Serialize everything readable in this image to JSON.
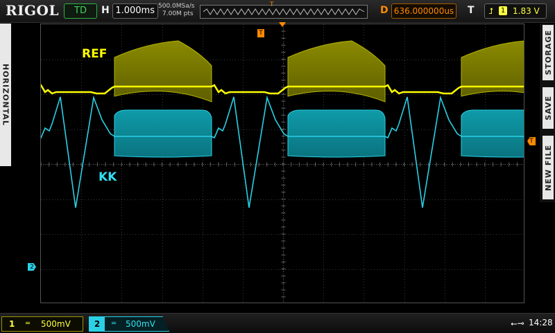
{
  "brand": "RIGOL",
  "status": "TD",
  "horizontal": {
    "label": "H",
    "timebase": "1.000ms",
    "sample_rate": "500.0MSa/s",
    "memory_depth": "7.00M pts"
  },
  "delay": {
    "label": "D",
    "value": "636.000000us"
  },
  "trigger": {
    "label": "T",
    "edge_icon": "rising-edge-icon",
    "source": "1",
    "level": "1.83 V"
  },
  "side_tabs": {
    "left": "HORIZONTAL",
    "right": [
      "STORAGE",
      "SAVE",
      "NEW FILE"
    ]
  },
  "markers": {
    "trigger": "T",
    "ch2": "2"
  },
  "waveform_labels": {
    "ref": "REF",
    "kk": "KK"
  },
  "channels": [
    {
      "number": "1",
      "coupling": "═",
      "scale": "500mV",
      "color": "#ffff00"
    },
    {
      "number": "2",
      "coupling": "═",
      "scale": "500mV",
      "color": "#2ad1e6"
    }
  ],
  "usb_icon": "usb-icon",
  "clock": "14:28",
  "colors": {
    "ch1": "#ffff00",
    "ch2": "#2ad1e6",
    "trigger": "#ff8a00",
    "grid": "#3a3a3a"
  }
}
